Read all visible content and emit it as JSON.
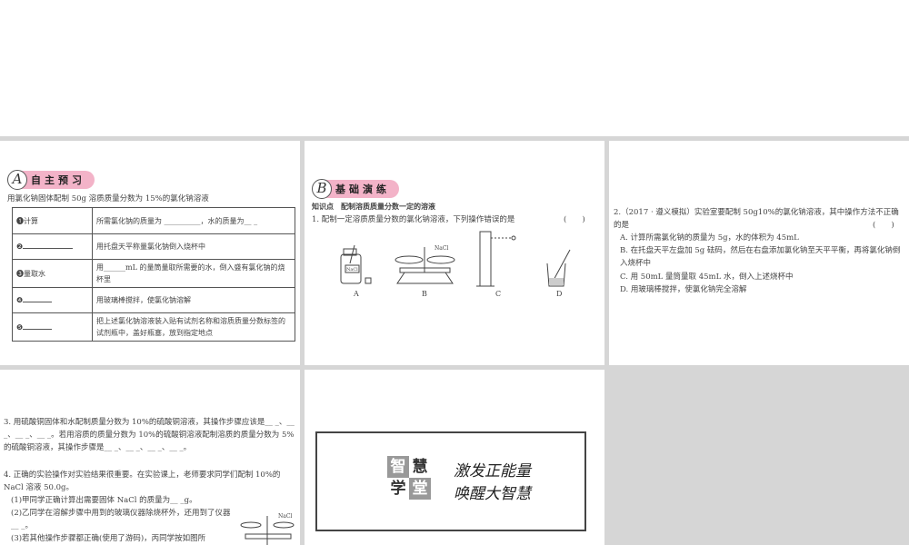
{
  "section_a": {
    "letter": "A",
    "title": "自主预习",
    "intro": "用氯化钠固体配制 50g 溶质质量分数为 15%的氯化钠溶液",
    "rows": [
      {
        "step": "❶计算",
        "desc": "所需氯化钠的质量为 __________，水的质量为__ _"
      },
      {
        "step": "❷",
        "desc": "用托盘天平称量氯化钠倒入烧杯中"
      },
      {
        "step": "❸量取水",
        "desc": "用______mL 的量筒量取所需要的水，倒入盛有氯化钠的烧杯里"
      },
      {
        "step": "❹",
        "desc": "用玻璃棒搅拌，使氯化钠溶解"
      },
      {
        "step": "❺",
        "desc": "把上述氯化钠溶液装入贴有试剂名称和溶质质量分数标签的试剂瓶中，盖好瓶塞，放到指定地点"
      }
    ]
  },
  "section_b": {
    "letter": "B",
    "title": "基础演练",
    "knowledge": "知识点　配制溶质质量分数一定的溶液",
    "q1": "1. 配制一定溶质质量分数的氯化钠溶液，下列操作错误的是",
    "paren": "(　　)",
    "fig_labels": [
      "A",
      "B",
      "C",
      "D"
    ],
    "nacl": "NaCl"
  },
  "q2": {
    "stem": "2.（2017 · 遵义模拟）实验室要配制 50g10%的氯化钠溶液，其中操作方法不正确的是",
    "paren": "(　　)",
    "options": [
      "A. 计算所需氯化钠的质量为 5g，水的体积为 45mL",
      "B. 在托盘天平左盘加 5g 砝码，然后在右盘添加氯化钠至天平平衡，再将氯化钠倒入烧杯中",
      "C. 用 50mL 量筒量取 45mL 水，倒入上述烧杯中",
      "D. 用玻璃棒搅拌，使氯化钠完全溶解"
    ]
  },
  "q3": "3. 用硫酸铜固体和水配制质量分数为 10%的硫酸铜溶液，其操作步骤应该是__ _、__ _、__ _、__ _。若用溶质的质量分数为 10%的硫酸铜溶液配制溶质的质量分数为 5%的硫酸铜溶液，其操作步骤是__ _、__ _、__ _、__ _。",
  "q4": {
    "stem": "4. 正确的实验操作对实验结果很重要。在实验课上，老师要求同学们配制 10%的 NaCl 溶液 50.0g。",
    "parts": [
      "(1)甲同学正确计算出需要固体 NaCl 的质量为__ _g。",
      "(2)乙同学在溶解步骤中用到的玻璃仪器除烧杯外，还用到了仪器__ _。",
      "(3)若其他操作步骤都正确(使用了游码)，丙同学按如图所"
    ],
    "nacl": "NaCl"
  },
  "banner": {
    "logo": [
      "智",
      "慧",
      "学",
      "堂"
    ],
    "line1": "激发正能量",
    "line2": "唤醒大智慧"
  }
}
